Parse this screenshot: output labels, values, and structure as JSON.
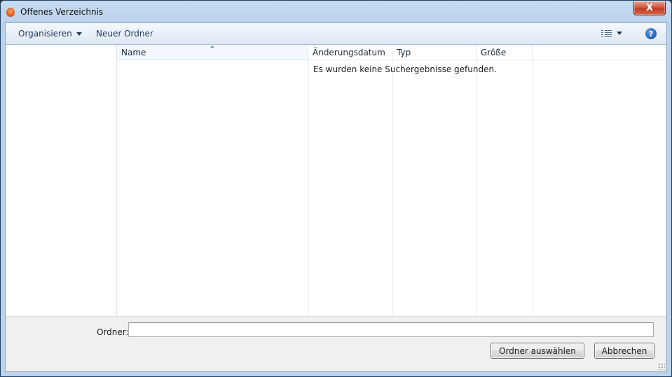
{
  "window": {
    "title": "Offenes Verzeichnis",
    "close_label": "X"
  },
  "toolbar": {
    "organize_label": "Organisieren",
    "new_folder_label": "Neuer Ordner",
    "help_label": "?"
  },
  "columns": [
    {
      "label": "Name",
      "sorted": "ascending"
    },
    {
      "label": "Änderungsdatum"
    },
    {
      "label": "Typ"
    },
    {
      "label": "Größe"
    }
  ],
  "list": {
    "empty_message": "Es wurden keine Suchergebnisse gefunden."
  },
  "bottom": {
    "folder_label": "Ordner:",
    "folder_value": "",
    "select_button": "Ordner auswählen",
    "cancel_button": "Abbrechen"
  },
  "colors": {
    "titlebar": "#bcd3ec",
    "close_button": "#c03b22",
    "help_icon": "#1f5cb6",
    "header_selected": "#f2f8fd"
  }
}
